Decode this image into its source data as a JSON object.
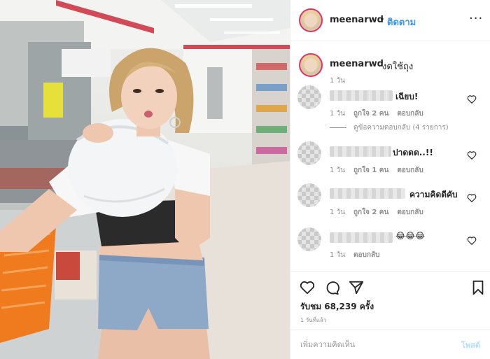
{
  "post": {
    "username": "meenarwd",
    "dot": "•",
    "follow_label": "ติดตาม",
    "more_label": "···"
  },
  "caption": {
    "username": "meenarwd",
    "text": "งดใช้ถุง",
    "time": "1 วัน"
  },
  "comments": [
    {
      "text": "เฉียบ!",
      "time": "1 วัน",
      "likes": "ถูกใจ 2 คน",
      "reply": "ตอบกลับ",
      "view_replies": "ดูข้อความตอบกลับ (4 รายการ)"
    },
    {
      "text": "ปาดดด..!!",
      "time": "1 วัน",
      "likes": "ถูกใจ 1 คน",
      "reply": "ตอบกลับ"
    },
    {
      "text": "ความคิดดีคับ",
      "time": "1 วัน",
      "likes": "ถูกใจ 2 คน",
      "reply": "ตอบกลับ"
    },
    {
      "text": "😂😂😂",
      "time": "1 วัน",
      "reply": "ตอบกลับ"
    }
  ],
  "stats": {
    "views": "รับชม 68,239 ครั้ง",
    "ago": "1 วันที่แล้ว"
  },
  "composer": {
    "placeholder": "เพิ่มความคิดเห็น",
    "post_label": "โพสต์"
  },
  "icons": [
    "heart-icon",
    "comment-icon",
    "share-icon",
    "bookmark-icon",
    "more-icon",
    "small-heart-icon"
  ],
  "colors": {
    "follow": "#3897f0",
    "post_disabled": "#b2dffc",
    "ring": "#e1306c",
    "meta": "#8e8e8e"
  }
}
